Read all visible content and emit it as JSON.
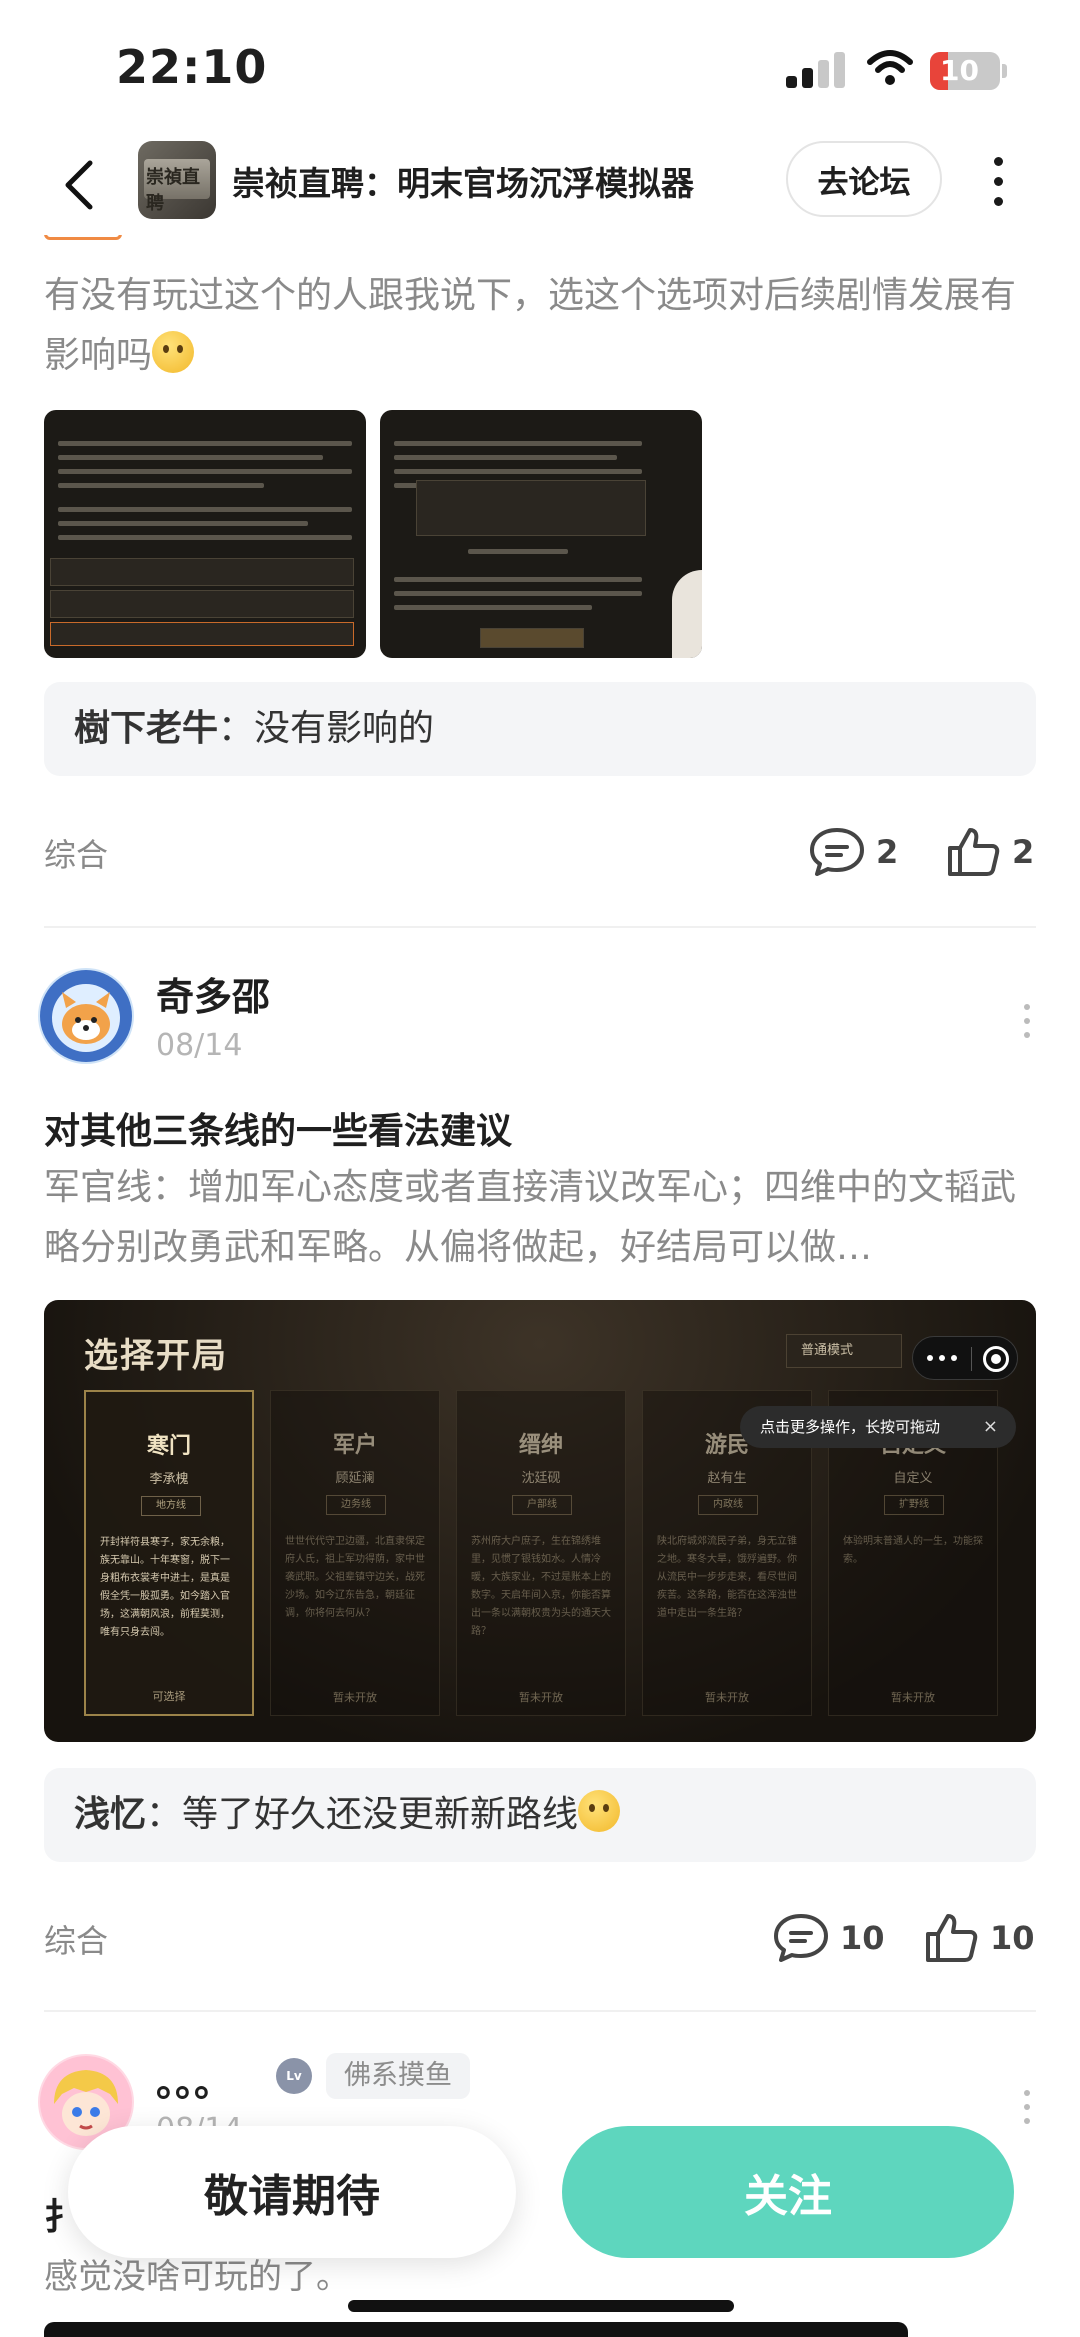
{
  "status_bar": {
    "time": "22:10",
    "battery": "10"
  },
  "header": {
    "app_title": "崇祯直聘：明末官场沉浮模拟器",
    "forum_button": "去论坛",
    "app_icon_text": "崇禎直聘"
  },
  "post1": {
    "desc": "有没有玩过这个的人跟我说下，选这个选项对后续剧情发展有影响吗",
    "comment_user": "樹下老牛",
    "comment_sep": "：",
    "comment_text": "没有影响的",
    "category": "综合",
    "comments": "2",
    "likes": "2"
  },
  "post2": {
    "user": "奇多邵",
    "date": "08/14",
    "title": "对其他三条线的一些看法建议",
    "desc": "军官线：增加军心态度或者直接清议改军心；四维中的文韬武略分别改勇武和军略。从偏将做起，好结局可以做…",
    "comment_user": "浅忆",
    "comment_sep": "：",
    "comment_text": "等了好久还没更新新路线",
    "category": "综合",
    "comments": "10",
    "likes": "10"
  },
  "game_image": {
    "title": "选择开局",
    "mode": "普通模式",
    "tooltip": "点击更多操作，长按可拖动",
    "tooltip_close": "×",
    "cards": [
      {
        "name": "寒门",
        "person": "李承槐",
        "badge": "地方线",
        "desc": "开封祥符县寒子，家无余粮，族无靠山。十年寒窗，脱下一身粗布衣裳考中进士，是真是假全凭一股孤勇。如今踏入官场，这满朝风浪，前程莫测，唯有只身去闯。",
        "foot": "可选择"
      },
      {
        "name": "军户",
        "person": "顾延澜",
        "badge": "边务线",
        "desc": "世世代代守卫边疆，北直隶保定府人氏，祖上军功得荫，家中世袭武职。父祖辈镇守边关，战死沙场。如今辽东告急，朝廷征调，你将何去何从？",
        "foot": "暂未开放"
      },
      {
        "name": "缙绅",
        "person": "沈廷砚",
        "badge": "户部线",
        "desc": "苏州府大户庶子，生在锦绣堆里，见惯了银钱如水。人情冷暖，大族家业，不过是账本上的数字。天启年间入京，你能否算出一条以满朝权贵为头的通天大路？",
        "foot": "暂未开放"
      },
      {
        "name": "游民",
        "person": "赵有生",
        "badge": "内政线",
        "desc": "陕北府城郊流民子弟，身无立锥之地。寒冬大旱，饿殍遍野。你从流民中一步步走来，看尽世间疾苦。这条路，能否在这浑浊世道中走出一条生路？",
        "foot": "暂未开放"
      },
      {
        "name": "自定义",
        "person": "自定义",
        "badge": "扩野线",
        "desc": "体验明末普通人的一生，功能探索。",
        "foot": "暂未开放"
      }
    ]
  },
  "post3": {
    "user": "。。。",
    "tag": "佛系摸鱼",
    "level_badge": "Lv",
    "date": "08/14",
    "desc": "感觉没啥可玩的了。",
    "title_partial": "扌"
  },
  "bottom_bar": {
    "wait_button": "敬请期待",
    "follow_button": "关注"
  },
  "colors": {
    "accent": "#5ed6be",
    "muted_text": "#8a8a8a",
    "comment_bg": "#f4f5f7"
  }
}
